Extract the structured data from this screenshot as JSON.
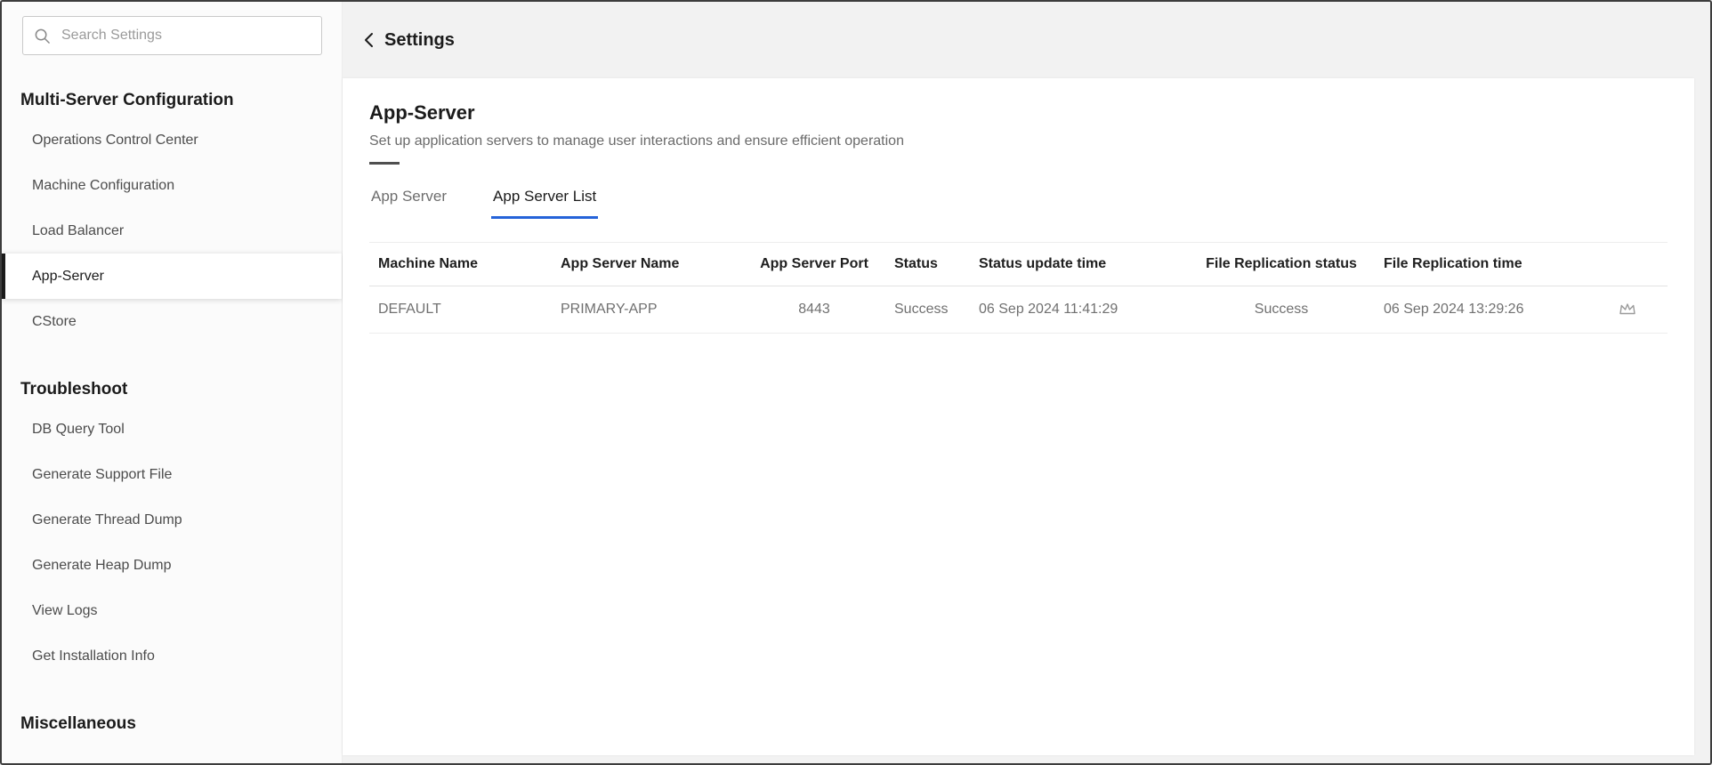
{
  "colors": {
    "accent_blue": "#2563d9",
    "active_marker": "#1a1a1a",
    "main_background": "#f2f2f2"
  },
  "sidebar": {
    "search_placeholder": "Search Settings",
    "active_item": "App-Server",
    "sections": [
      {
        "title": "Multi-Server Configuration",
        "items": [
          "Operations Control Center",
          "Machine Configuration",
          "Load Balancer",
          "App-Server",
          "CStore"
        ]
      },
      {
        "title": "Troubleshoot",
        "items": [
          "DB Query Tool",
          "Generate Support File",
          "Generate Thread Dump",
          "Generate Heap Dump",
          "View Logs",
          "Get Installation Info"
        ]
      },
      {
        "title": "Miscellaneous",
        "items": []
      }
    ]
  },
  "header": {
    "back_label": "Settings"
  },
  "content": {
    "title": "App-Server",
    "subtitle": "Set up application servers to manage user interactions and ensure efficient operation",
    "tabs": [
      {
        "label": "App Server",
        "active": false
      },
      {
        "label": "App Server List",
        "active": true
      }
    ],
    "table": {
      "columns": [
        "Machine Name",
        "App Server Name",
        "App Server Port",
        "Status",
        "Status update time",
        "File Replication status",
        "File Replication time",
        ""
      ],
      "rows": [
        {
          "machine_name": "DEFAULT",
          "app_server_name": "PRIMARY-APP",
          "app_server_port": "8443",
          "status": "Success",
          "status_update_time": "06 Sep 2024 11:41:29",
          "file_replication_status": "Success",
          "file_replication_time": "06 Sep 2024 13:29:26",
          "action_icon": "crown-icon"
        }
      ]
    }
  }
}
